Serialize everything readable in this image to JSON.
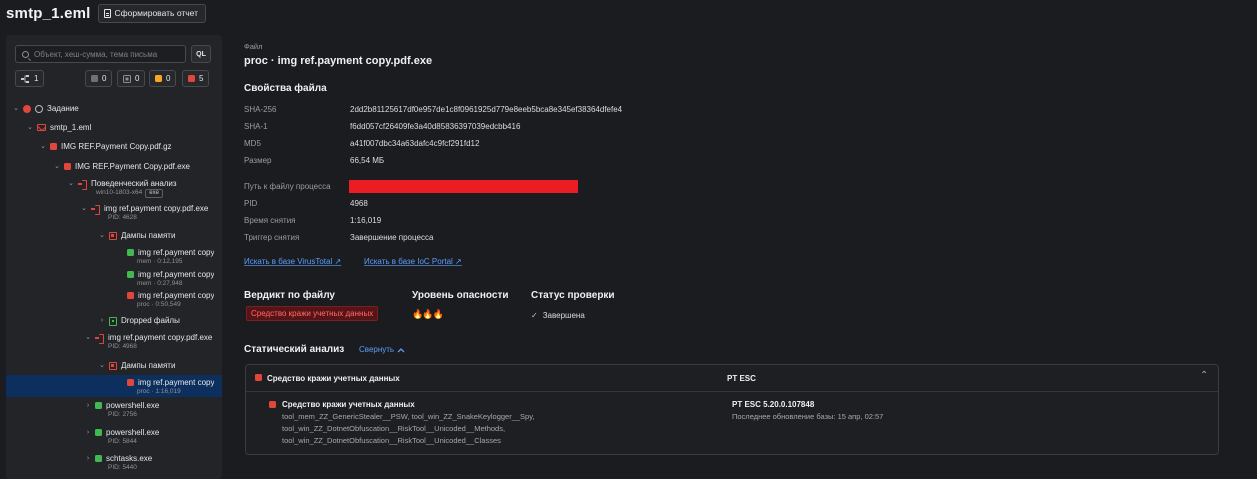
{
  "header": {
    "title": "smtp_1.eml",
    "report_button": "Сформировать отчет"
  },
  "sidebar": {
    "search_placeholder": "Объект, хеш-сумма, тема письма",
    "ql_label": "QL",
    "chips": {
      "graph_count": "1",
      "gray_count": "0",
      "gray2_count": "0",
      "orange_count": "0",
      "red_count": "5"
    },
    "tree": [
      {
        "label": "Задание"
      },
      {
        "label": "smtp_1.eml"
      },
      {
        "label": "IMG REF.Payment Copy.pdf.gz"
      },
      {
        "label": "IMG REF.Payment Copy.pdf.exe"
      },
      {
        "label": "Поведенческий анализ",
        "sub": "win10-1803-x64",
        "tag": "exe"
      },
      {
        "label": "img ref.payment copy.pdf.exe",
        "sub": "PID: 4628"
      },
      {
        "label": "Дампы памяти"
      },
      {
        "label": "img ref.payment copy",
        "sub": "mem · 0:12,195"
      },
      {
        "label": "img ref.payment copy",
        "sub": "mem · 0:27,948"
      },
      {
        "label": "img ref.payment copy",
        "sub": "proc · 0:50,549"
      },
      {
        "label": "Dropped файлы"
      },
      {
        "label": "img ref.payment copy.pdf.exe",
        "sub": "PID: 4968"
      },
      {
        "label": "Дампы памяти"
      },
      {
        "label": "img ref.payment copy",
        "sub": "proc · 1:16,019"
      },
      {
        "label": "powershell.exe",
        "sub": "PID: 2756"
      },
      {
        "label": "powershell.exe",
        "sub": "PID: 5844"
      },
      {
        "label": "schtasks.exe",
        "sub": "PID: 5440"
      }
    ]
  },
  "main": {
    "file_caption": "Файл",
    "file_name": "proc · img ref.payment copy.pdf.exe",
    "props_title": "Свойства файла",
    "props": [
      {
        "key": "SHA-256",
        "value": "2dd2b81125617df0e957de1c8f0961925d779e8eeb5bca8e345ef38364dfefe4"
      },
      {
        "key": "SHA-1",
        "value": "f6dd057cf26409fe3a40d85836397039edcbb416"
      },
      {
        "key": "MD5",
        "value": "a41f007dbc34a63dafc4c9fcf291fd12"
      },
      {
        "key": "Размер",
        "value": "66,54 МБ"
      },
      {
        "key": "Путь к файлу процесса",
        "value": ""
      },
      {
        "key": "PID",
        "value": "4968"
      },
      {
        "key": "Время снятия",
        "value": "1:16,019"
      },
      {
        "key": "Триггер снятия",
        "value": "Завершение процесса"
      }
    ],
    "links": {
      "virustotal": "Искать в базе VirusTotal",
      "ioc": "Искать в базе IoC Portal"
    },
    "verdict_title": "Вердикт по файлу",
    "verdict_value": "Средство кражи учетных данных",
    "danger_title": "Уровень опасности",
    "danger_level": 2,
    "danger_max": 3,
    "status_title": "Статус проверки",
    "status_value": "Завершена",
    "static_title": "Статический анализ",
    "collapse_label": "Свернуть",
    "panel": {
      "head_verdict": "Средство кражи учетных данных",
      "head_engine": "PT ESC",
      "rule_title": "Средство кражи учетных данных",
      "rule_lines": [
        "tool_mem_ZZ_GenericStealer__PSW, tool_win_ZZ_SnakeKeylogger__Spy,",
        "tool_win_ZZ_DotnetObfuscation__RiskTool__Unicoded__Methods,",
        "tool_win_ZZ_DotnetObfuscation__RiskTool__Unicoded__Classes"
      ],
      "engine_version": "PT ESC 5.20.0.107848",
      "engine_update": "Последнее обновление базы: 15 апр, 02:57"
    },
    "colors": {
      "accent_link": "#5b9ef8",
      "danger_red": "#e0463a",
      "selected_row": "#0d2f5e"
    }
  }
}
